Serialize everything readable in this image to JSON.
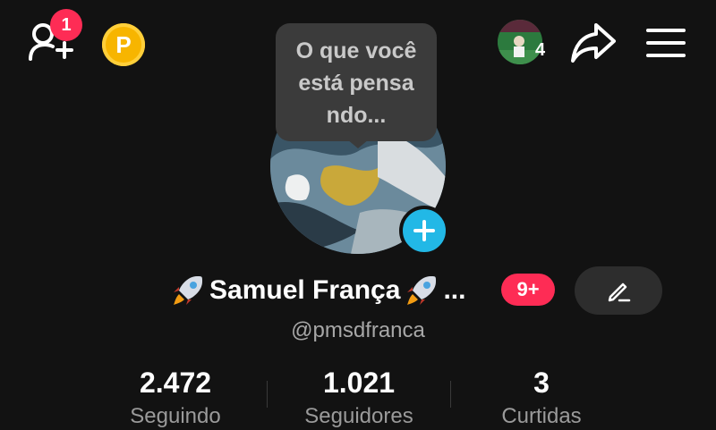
{
  "header": {
    "notification_count": "1",
    "coin_letter": "P",
    "story_count": "4",
    "icons": [
      "add-friend-icon",
      "coin-icon",
      "share-icon",
      "menu-icon"
    ]
  },
  "bubble": {
    "line1": "O que você",
    "line2": "está pensa",
    "line3": "ndo..."
  },
  "profile": {
    "name": "Samuel França",
    "name_ellipsis": "...",
    "handle": "@pmsdfranca",
    "message_badge": "9+"
  },
  "stats": [
    {
      "value": "2.472",
      "label": "Seguindo"
    },
    {
      "value": "1.021",
      "label": "Seguidores"
    },
    {
      "value": "3",
      "label": "Curtidas"
    }
  ],
  "colors": {
    "background": "#121212",
    "badge": "#fe2c55",
    "add_photo": "#22b8e6",
    "coin": "#f7b500"
  }
}
